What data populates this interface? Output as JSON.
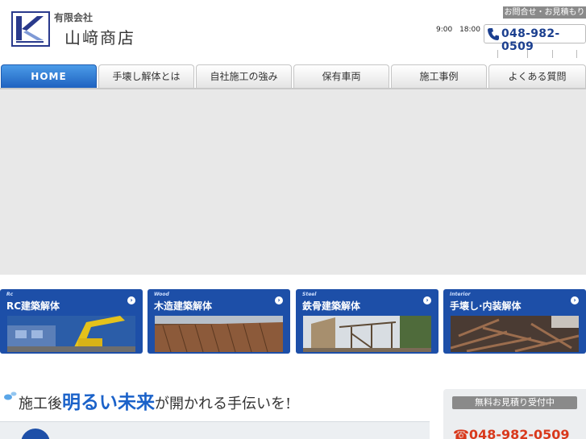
{
  "header": {
    "logo_icon": "k-monogram-logo",
    "company_type": "有限会社",
    "company_name": "山﨑商店",
    "hours": "9:00 18:00",
    "contact_label": "お問合せ・お見積もり",
    "phone_icon": "phone-icon",
    "phone": "048-982-0509"
  },
  "nav": {
    "tabs": [
      {
        "label": "HOME",
        "active": true
      },
      {
        "label": "手壊し解体とは"
      },
      {
        "label": "自社施工の強み"
      },
      {
        "label": "保有車両"
      },
      {
        "label": "施工事例"
      },
      {
        "label": "よくある質問"
      }
    ]
  },
  "services": [
    {
      "tag": "Rc",
      "title": "RC建築解体"
    },
    {
      "tag": "Wood",
      "title": "木造建築解体"
    },
    {
      "tag": "Steel",
      "title": "鉄骨建築解体"
    },
    {
      "tag": "Interior",
      "title": "手壊し·内装解体"
    }
  ],
  "tagline": {
    "p1": "施工後",
    "p2": "明るい未来",
    "p3": "が開かれる手伝いを!"
  },
  "side": {
    "estimate_label": "無料お見積り受付中",
    "phone": "☎048-982-0509"
  },
  "colors": {
    "brand_blue": "#1d4fa8",
    "accent_red": "#d9391c",
    "nav_active": "#2a74d6"
  }
}
